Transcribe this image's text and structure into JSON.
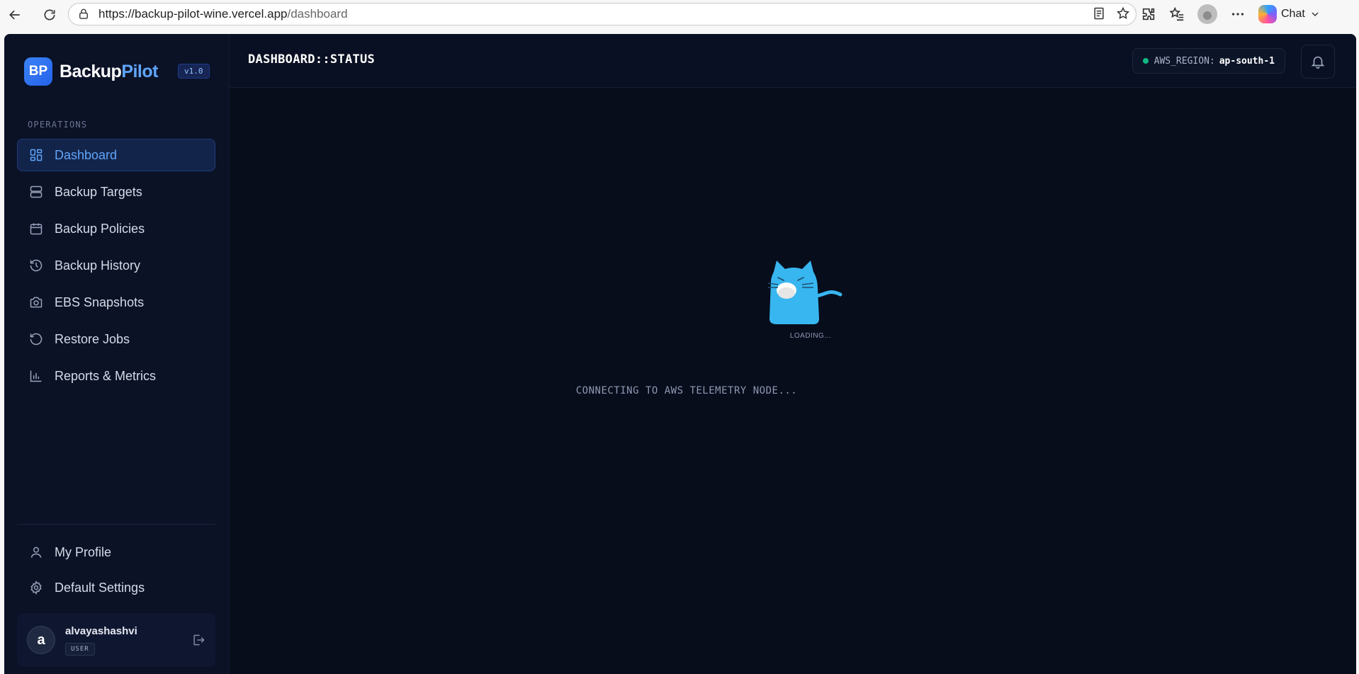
{
  "browser": {
    "url_host": "https://backup-pilot-wine.vercel.app",
    "url_path": "/dashboard",
    "chat_label": "Chat"
  },
  "brand": {
    "logo_text": "BP",
    "name_primary": "Backup",
    "name_accent": "Pilot",
    "version": "v1.0",
    "accent_color": "#3b82f6"
  },
  "sidebar": {
    "section_label": "OPERATIONS",
    "items": [
      {
        "label": "Dashboard",
        "icon": "dashboard-grid-icon",
        "active": true
      },
      {
        "label": "Backup Targets",
        "icon": "server-icon"
      },
      {
        "label": "Backup Policies",
        "icon": "calendar-icon"
      },
      {
        "label": "Backup History",
        "icon": "history-icon"
      },
      {
        "label": "EBS Snapshots",
        "icon": "camera-icon"
      },
      {
        "label": "Restore Jobs",
        "icon": "restore-icon"
      },
      {
        "label": "Reports & Metrics",
        "icon": "bar-chart-icon"
      }
    ],
    "bottom_items": [
      {
        "label": "My Profile",
        "icon": "user-icon"
      },
      {
        "label": "Default Settings",
        "icon": "gear-icon"
      }
    ]
  },
  "user": {
    "initial": "a",
    "name": "alvayashashvi",
    "role": "USER"
  },
  "header": {
    "title": "DASHBOARD::STATUS",
    "region_label": "AWS_REGION:",
    "region_value": "ap-south-1",
    "status_color": "#10b981"
  },
  "loader": {
    "loading_text": "LOADING...",
    "message": "CONNECTING TO AWS TELEMETRY NODE..."
  }
}
